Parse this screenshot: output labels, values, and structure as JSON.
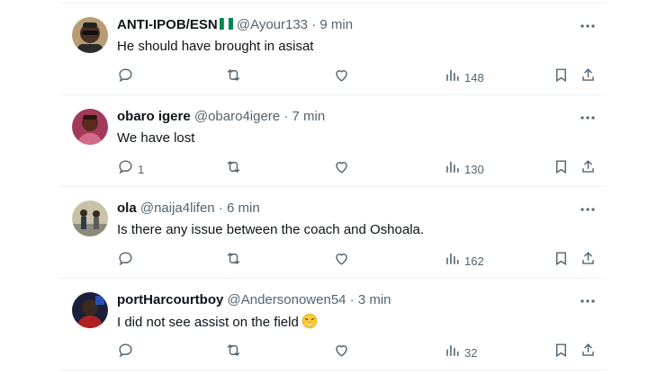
{
  "tweets": [
    {
      "name": "ANTI-IPOB/ESN",
      "handle": "@Ayour133",
      "sep": "·",
      "time": "9 min",
      "text": "He should have brought in asisat",
      "replies": "",
      "views": "148",
      "flag": "nigeria-flag-icon"
    },
    {
      "name": "obaro igere",
      "handle": "@obaro4igere",
      "sep": "·",
      "time": "7 min",
      "text": "We have lost",
      "replies": "1",
      "views": "130"
    },
    {
      "name": "ola",
      "handle": "@naija4lifen",
      "sep": "·",
      "time": "6 min",
      "text": "Is there any issue between the coach and Oshoala.",
      "replies": "",
      "views": "162"
    },
    {
      "name": "portHarcourtboy",
      "handle": "@Andersonowen54",
      "sep": "·",
      "time": "3 min",
      "text": "I did not see assist on the field",
      "replies": "",
      "views": "32",
      "emoji": "weary-face-icon"
    }
  ],
  "colors": {
    "text": "#0f1419",
    "muted": "#536471",
    "divider": "#eff3f4",
    "flag_green": "#008751"
  }
}
